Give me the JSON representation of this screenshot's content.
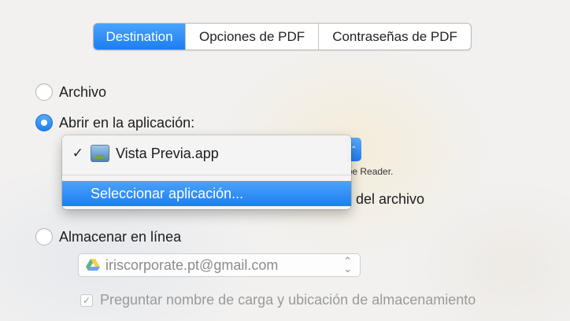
{
  "tabs": [
    {
      "label": "Destination",
      "active": true
    },
    {
      "label": "Opciones de PDF",
      "active": false
    },
    {
      "label": "Contraseñas de PDF",
      "active": false
    }
  ],
  "options": {
    "archivo": "Archivo",
    "abrir": "Abrir en la aplicación:",
    "almacenar": "Almacenar en línea",
    "selected": "abrir"
  },
  "popup": {
    "selected_check": "✓",
    "app_name": "Vista Previa.app",
    "highlighted_item": "Seleccionar aplicación..."
  },
  "background_hidden": {
    "hint_fragment": "obe Reader.",
    "text_fragment": "del archivo"
  },
  "account": {
    "value": "iriscorporate.pt@gmail.com",
    "arrows": "⌃⌄"
  },
  "checkbox": {
    "label": "Preguntar nombre de carga y ubicación de almacenamiento",
    "checked": true,
    "check_mark": "✓"
  },
  "colors": {
    "accent": "#1d7ef2",
    "disabled_text": "#9a9a9a"
  }
}
